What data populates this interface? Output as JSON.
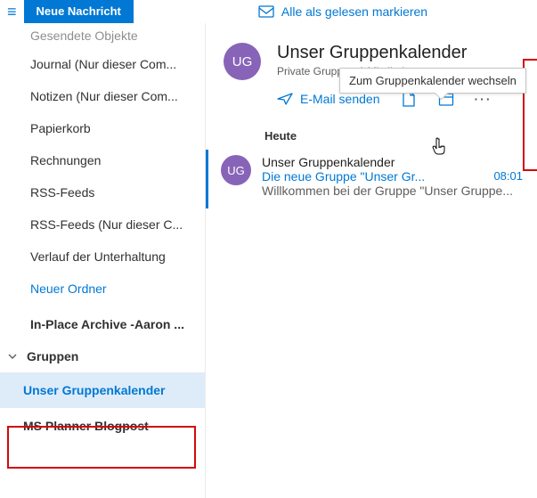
{
  "topbar": {
    "new_message": "Neue Nachricht",
    "mark_all_read": "Alle als gelesen markieren"
  },
  "sidebar": {
    "cut_item": "Gesendete Objekte",
    "items": [
      "Journal (Nur dieser Com...",
      "Notizen (Nur dieser Com...",
      "Papierkorb",
      "Rechnungen",
      "RSS-Feeds",
      "RSS-Feeds (Nur dieser C...",
      "Verlauf der Unterhaltung"
    ],
    "new_folder": "Neuer Ordner",
    "archive_section": "In-Place Archive -Aaron ...",
    "groups_label": "Gruppen",
    "group_items": [
      "Unser Gruppenkalender",
      "MS Planner Blogpost"
    ]
  },
  "group": {
    "initials": "UG",
    "name": "Unser Gruppenkalender",
    "privacy": "Private Gruppe",
    "members": "1 Mitglied",
    "send_email": "E-Mail senden",
    "tooltip": "Zum Gruppenkalender wechseln"
  },
  "list": {
    "today": "Heute",
    "msg": {
      "initials": "UG",
      "from": "Unser Gruppenkalender",
      "subject": "Die neue Gruppe \"Unser Gr...",
      "time": "08:01",
      "preview": "Willkommen bei der Gruppe \"Unser Gruppe..."
    }
  }
}
